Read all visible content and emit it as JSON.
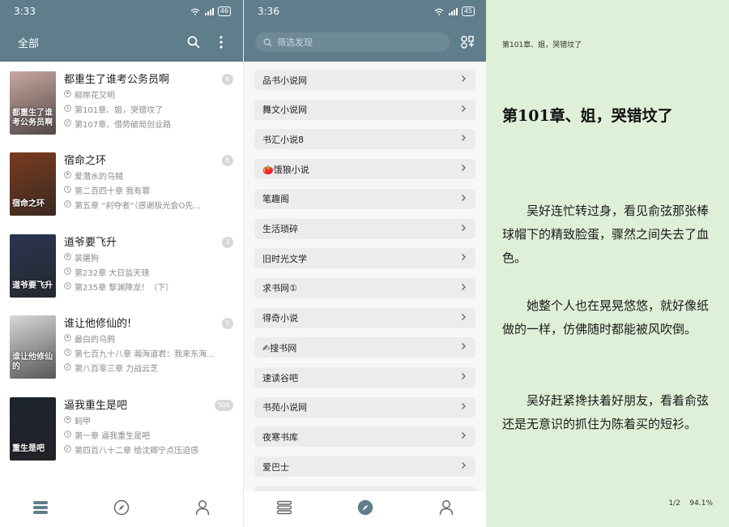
{
  "colors": {
    "accent": "#5f7d8b",
    "reader_bg": "#dff0d8",
    "badge": "#d8d8d8"
  },
  "shelf": {
    "status": {
      "time": "3:33",
      "battery": "46"
    },
    "title": "全部",
    "icons": [
      "search-icon",
      "more-vert-icon"
    ],
    "books": [
      {
        "title": "都重生了谁考公务员啊",
        "author": "柳岸花又明",
        "last_read": "第101章、姐，哭错坟了",
        "latest": "第107章、借势破局创业路",
        "unread": "6",
        "cover_text": "都重生了谁考公务员啊",
        "cover_color": "#c9a7a0"
      },
      {
        "title": "宿命之环",
        "author": "爱潜水的乌贼",
        "last_read": "第二百四十章 我有罪",
        "latest": "第五章 “刹夺者”（感谢极光会O先...",
        "unread": "6",
        "cover_text": "宿命之环",
        "cover_color": "#7a3b1f"
      },
      {
        "title": "道爷要飞升",
        "author": "裴屠狗",
        "last_read": "第232章 大日监天镜",
        "latest": "第235章 黎渊降龙！（下）",
        "unread": "3",
        "cover_text": "道爷要飞升",
        "cover_color": "#2a3550"
      },
      {
        "title": "谁让他修仙的!",
        "author": "最白的乌鸦",
        "last_read": "第七百九十八章 瀚海道君：我来东海...",
        "latest": "第八百零三章 力战云芝",
        "unread": "5",
        "cover_text": "谁让他修仙的",
        "cover_color": "#d8d8d6"
      },
      {
        "title": "逼我重生是吧",
        "author": "蚂甲",
        "last_read": "第一章 逼我重生是吧",
        "latest": "第四百八十二章 给沈卿宁点压迫感",
        "unread": "506",
        "cover_text": "重生是吧",
        "cover_color": "#1e2430"
      }
    ],
    "nav": [
      "bookshelf-icon",
      "explore-icon",
      "profile-icon"
    ]
  },
  "sources": {
    "status": {
      "time": "3:36",
      "battery": "45"
    },
    "search_placeholder": "筛选发现",
    "items": [
      "品书小说网",
      "舞文小说网",
      "书汇小说8",
      "🍅饿狼小说",
      "笔趣阁",
      "生活琐碎",
      "旧时光文学",
      "求书网①",
      "得奇小说",
      "✍搜书网",
      "速读谷吧",
      "书苑小说网",
      "夜寒书库",
      "爱巴士"
    ],
    "nav": [
      "bookshelf-icon",
      "explore-icon",
      "profile-icon"
    ]
  },
  "reader": {
    "header": "第101章、姐，哭错坟了",
    "chapter_title": "第101章、姐，哭错坟了",
    "paragraphs": [
      "吴好连忙转过身，看见俞弦那张棒球帽下的精致脸蛋，骤然之间失去了血色。",
      "她整个人也在晃晃悠悠，就好像纸做的一样，仿佛随时都能被风吹倒。",
      "吴好赶紧搀扶着好朋友，看着俞弦还是无意识的抓住为陈着买的短衫。"
    ],
    "page": "1/2",
    "progress": "94.1%"
  }
}
